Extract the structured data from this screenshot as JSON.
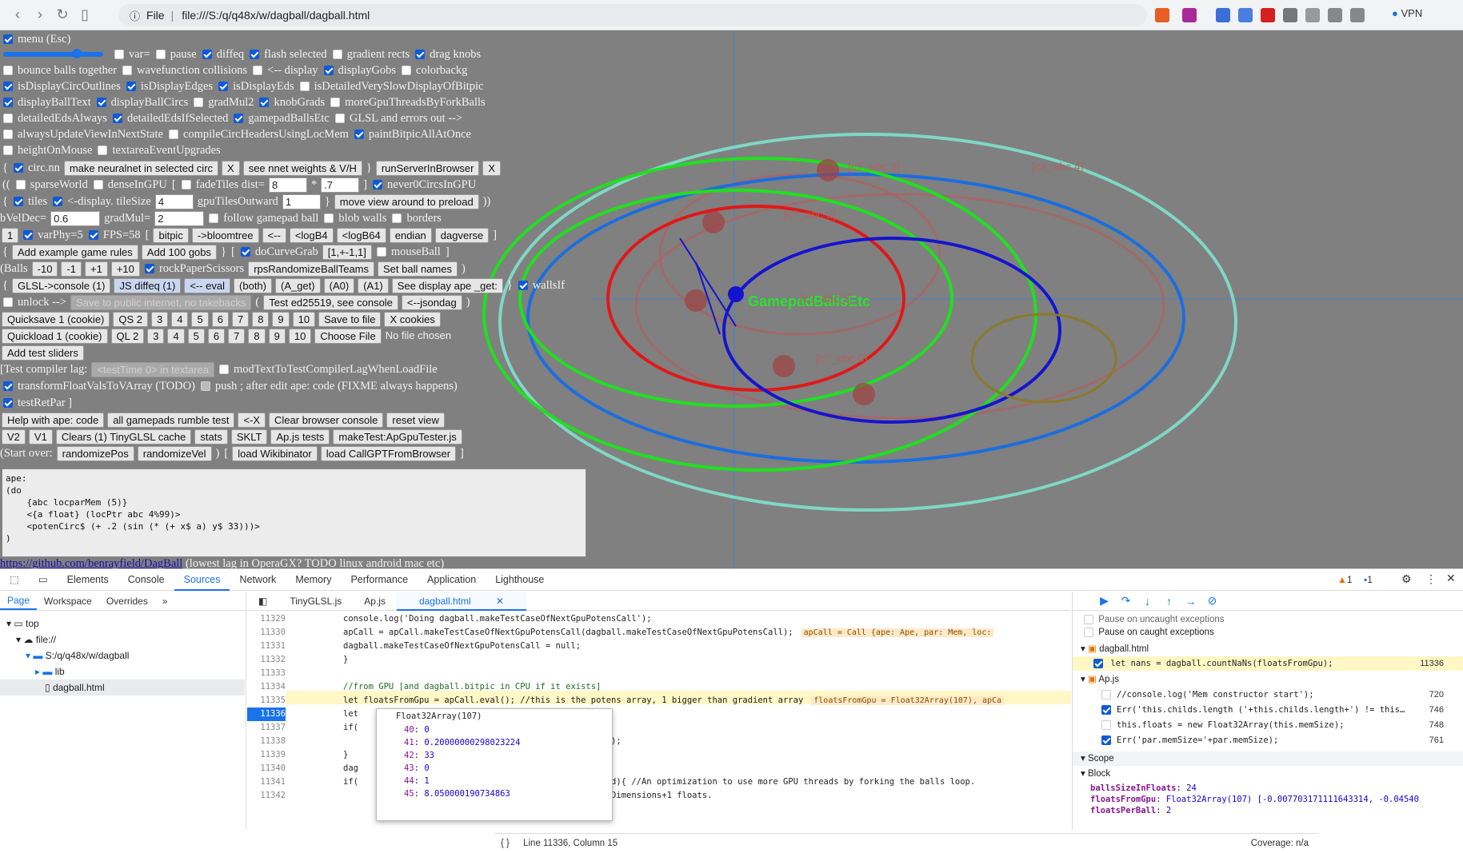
{
  "browser": {
    "file_label": "File",
    "url": "file:///S:/q/q48x/w/dagball/dagball.html",
    "vpn": "VPN"
  },
  "controls": {
    "menu": "menu (Esc)",
    "r2": [
      "var=",
      "pause",
      "diffeq",
      "flash selected",
      "gradient rects",
      "drag knobs"
    ],
    "r3": [
      "bounce balls together",
      "wavefunction collisions",
      "<-- display",
      "displayGobs",
      "colorbackg"
    ],
    "r4": [
      "isDisplayCircOutlines",
      "isDisplayEdges",
      "isDisplayEds",
      "isDetailedVerySlowDisplayOfBitpic"
    ],
    "r5": [
      "displayBallText",
      "displayBallCircs",
      "gradMul2",
      "knobGrads",
      "moreGpuThreadsByForkBalls"
    ],
    "r6": [
      "detailedEdsAlways",
      "detailedEdsIfSelected",
      "gamepadBallsEtc",
      "GLSL and errors out -->"
    ],
    "r7": [
      "alwaysUpdateViewInNextState",
      "compileCircHeadersUsingLocMem",
      "paintBitpicAllAtOnce"
    ],
    "r8": [
      "heightOnMouse",
      "textareaEventUpgrades"
    ],
    "r9": {
      "circnn": "circ.nn",
      "b1": "make neuralnet in selected circ",
      "x1": "X",
      "b2": "see nnet weights & V/H",
      "b3": "runServerInBrowser",
      "x2": "X"
    },
    "r10": {
      "a": "sparseWorld",
      "b": "denseInGPU",
      "c": "fadeTiles dist=",
      "v1": "8",
      "star": "*",
      "v2": ".7",
      "d": "never0CircsInGPU"
    },
    "r11": {
      "a": "tiles",
      "b": "<-display. tileSize",
      "v1": "4",
      "c": "gpuTilesOutward",
      "v2": "1",
      "btn": "move view around to preload"
    },
    "r12": {
      "a": "bVelDec=",
      "v1": "0.6",
      "b": "gradMul=",
      "v2": "2",
      "c": "follow gamepad ball",
      "d": "blob walls",
      "e": "borders"
    },
    "r13": {
      "n1": "1",
      "a": "varPhy=5",
      "b": "FPS=58",
      "btns": [
        "bitpic",
        "->bloomtree",
        "<--",
        "<logB4",
        "<logB64",
        "endian",
        "dagverse"
      ]
    },
    "r14": {
      "b1": "Add example game rules",
      "b2": "Add 100 gobs",
      "a": "doCurveGrab",
      "b3": "[1,+-1,1]",
      "c": "mouseBall"
    },
    "r15": {
      "lbl": "(Balls",
      "btns": [
        "-10",
        "-1",
        "+1",
        "+10"
      ],
      "a": "rockPaperScissors",
      "b1": "rpsRandomizeBallTeams",
      "b2": "Set ball names"
    },
    "r16": {
      "btns": [
        "GLSL->console (1)",
        "JS diffeq (1)",
        "<-- eval",
        "(both)",
        "(A_get)",
        "(A0)",
        "(A1)",
        "See display ape _get:"
      ],
      "a": "wallsIf"
    },
    "r17": {
      "a": "unlock -->",
      "dis": "Save to public internet, no takebacks",
      "b1": "Test ed25519, see console",
      "b2": "<--jsondag"
    },
    "r18": {
      "btns": [
        "Quicksave 1 (cookie)",
        "QS 2",
        "3",
        "4",
        "5",
        "6",
        "7",
        "8",
        "9",
        "10",
        "Save to file",
        "X cookies"
      ]
    },
    "r19": {
      "btns": [
        "Quickload 1 (cookie)",
        "QL 2",
        "3",
        "4",
        "5",
        "6",
        "7",
        "8",
        "9",
        "10",
        "Choose File"
      ],
      "nofile": "No file chosen"
    },
    "r20": {
      "b": "Add test sliders"
    },
    "r21": {
      "a": "[Test compiler lag:",
      "dis": "<testTime 0> in textarea",
      "b": "modTextToTestCompilerLagWhenLoadFile"
    },
    "r22": {
      "a": "transformFloatValsToVArray (TODO)",
      "b": "push ; after edit ape: code (FIXME always happens)"
    },
    "r23": {
      "a": "testRetPar ]"
    },
    "r24": {
      "btns": [
        "Help with ape: code",
        "all gamepads rumble test",
        "<-X",
        "Clear browser console",
        "reset view"
      ]
    },
    "r25": {
      "btns": [
        "V2",
        "V1",
        "Clears (1) TinyGLSL cache",
        "stats",
        "SKLT",
        "Ap.js tests",
        "makeTest:ApGpuTester.js"
      ]
    },
    "r26": {
      "a": "(Start over:",
      "btns": [
        "randomizePos",
        "randomizeVel",
        "load Wikibinator",
        "load CallGPTFromBrowser"
      ]
    },
    "textarea": "ape:\n(do\n    {abc locparMem (5)}\n    <{a float} (locPtr abc 4%99)>\n    <potenCirc$ (+ .2 (sin (* (+ x$ a) y$ 33)))>\n)",
    "link": "https://github.com/benrayfield/DagBall",
    "link_note": " (lowest lag in OperaGX? TODO linux android mac etc)"
  },
  "viz": {
    "labels": [
      "GamepadBallsEtc",
      "[c?_abc 1]",
      "[c?_abc 2]",
      "[c?_abc 0]",
      "[ce_abc 4]",
      "[c?_abc 3]"
    ]
  },
  "devtools": {
    "tabs": [
      "Elements",
      "Console",
      "Sources",
      "Network",
      "Memory",
      "Performance",
      "Application",
      "Lighthouse"
    ],
    "warn": "1",
    "info": "1",
    "nav_tabs": [
      "Page",
      "Workspace",
      "Overrides"
    ],
    "tree": [
      "top",
      "file://",
      "S:/q/q48x/w/dagball",
      "lib",
      "dagball.html"
    ],
    "editor_tabs": [
      "TinyGLSL.js",
      "Ap.js",
      "dagball.html"
    ],
    "lines": [
      {
        "n": "11329",
        "c": "console.log('Doing dagball.makeTestCaseOfNextGpuPotensCall');"
      },
      {
        "n": "11330",
        "c": "apCall = apCall.makeTestCaseOfNextGpuPotensCall(dagball.makeTestCaseOfNextGpuPotensCall);",
        "inl": "apCall = Call {ape: Ape, par: Mem, loc:"
      },
      {
        "n": "11331",
        "c": "dagball.makeTestCaseOfNextGpuPotensCall = null;"
      },
      {
        "n": "11332",
        "c": "}"
      },
      {
        "n": "11333",
        "c": ""
      },
      {
        "n": "11334",
        "c": "//from GPU [and dagball.bitpic in CPU if it exists]"
      },
      {
        "n": "11335",
        "c": "let floatsFromGpu = apCall.eval(); //this is the potens array, 1 bigger than gradient array",
        "inl": "floatsFromGpu = Float32Array(107), apCa"
      },
      {
        "n": "11336",
        "c": "let"
      },
      {
        "n": "11337",
        "c": "if("
      },
      {
        "n": "11338",
        "c": "                                         oatsFromGpu]);"
      },
      {
        "n": "11339",
        "c": "}"
      },
      {
        "n": "11340",
        "c": "dag"
      },
      {
        "n": "11341",
        "c": "if(                                    Balls').checked){ //An optimization to use more GPU threads by forking the balls loop."
      },
      {
        "n": "11342",
        "c": "                                        nstead of numDimensions+1 floats."
      }
    ],
    "tooltip": {
      "title": "Float32Array(107)",
      "rows": [
        [
          "40",
          "0"
        ],
        [
          "41",
          "0.20000000298023224"
        ],
        [
          "42",
          "33"
        ],
        [
          "43",
          "0"
        ],
        [
          "44",
          "1"
        ],
        [
          "45",
          "8.050000190734863"
        ]
      ]
    },
    "status": "Line 11336, Column 15",
    "coverage": "Coverage: n/a",
    "dbg": {
      "p1": "Pause on uncaught exceptions",
      "p2": "Pause on caught exceptions",
      "f1": "dagball.html",
      "bp1": "let nans = dagball.countNaNs(floatsFromGpu);",
      "bp1n": "11336",
      "f2": "Ap.js",
      "bps": [
        [
          "//console.log('Mem constructor start');",
          "720"
        ],
        [
          "Err('this.childs.length ('+this.childs.length+') != this…",
          "746"
        ],
        [
          "this.floats = new Float32Array(this.memSize);",
          "748"
        ],
        [
          "Err('par.memSize='+par.memSize);",
          "761"
        ]
      ],
      "scope": "Scope",
      "block": "Block",
      "vars": [
        [
          "ballsSizeInFloats",
          "24"
        ],
        [
          "floatsFromGpu",
          "Float32Array(107) [-0.007703171111643314, -0.04540"
        ],
        [
          "floatsPerBall",
          "2"
        ]
      ]
    }
  },
  "colors": {
    "page_bg": "#808080",
    "accent": "#1a73e8"
  }
}
